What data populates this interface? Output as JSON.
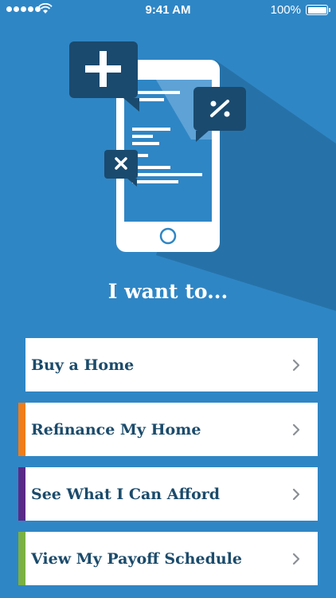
{
  "status_bar": {
    "time": "9:41 AM",
    "battery": "100%"
  },
  "headline": "I want to...",
  "options": [
    {
      "label": "Buy a Home",
      "accent_color": "#2f86c5"
    },
    {
      "label": "Refinance My Home",
      "accent_color": "#f07d18"
    },
    {
      "label": "See What I Can Afford",
      "accent_color": "#5a2a87"
    },
    {
      "label": "View My Payoff Schedule",
      "accent_color": "#7bb142"
    }
  ],
  "colors": {
    "background": "#2f86c5",
    "dark_navy": "#1a4a6e",
    "label_text": "#1b4b6b"
  },
  "icons": [
    "signal-dots-icon",
    "wifi-icon",
    "battery-icon",
    "plus-icon",
    "percent-icon",
    "times-icon",
    "chevron-right-icon"
  ]
}
